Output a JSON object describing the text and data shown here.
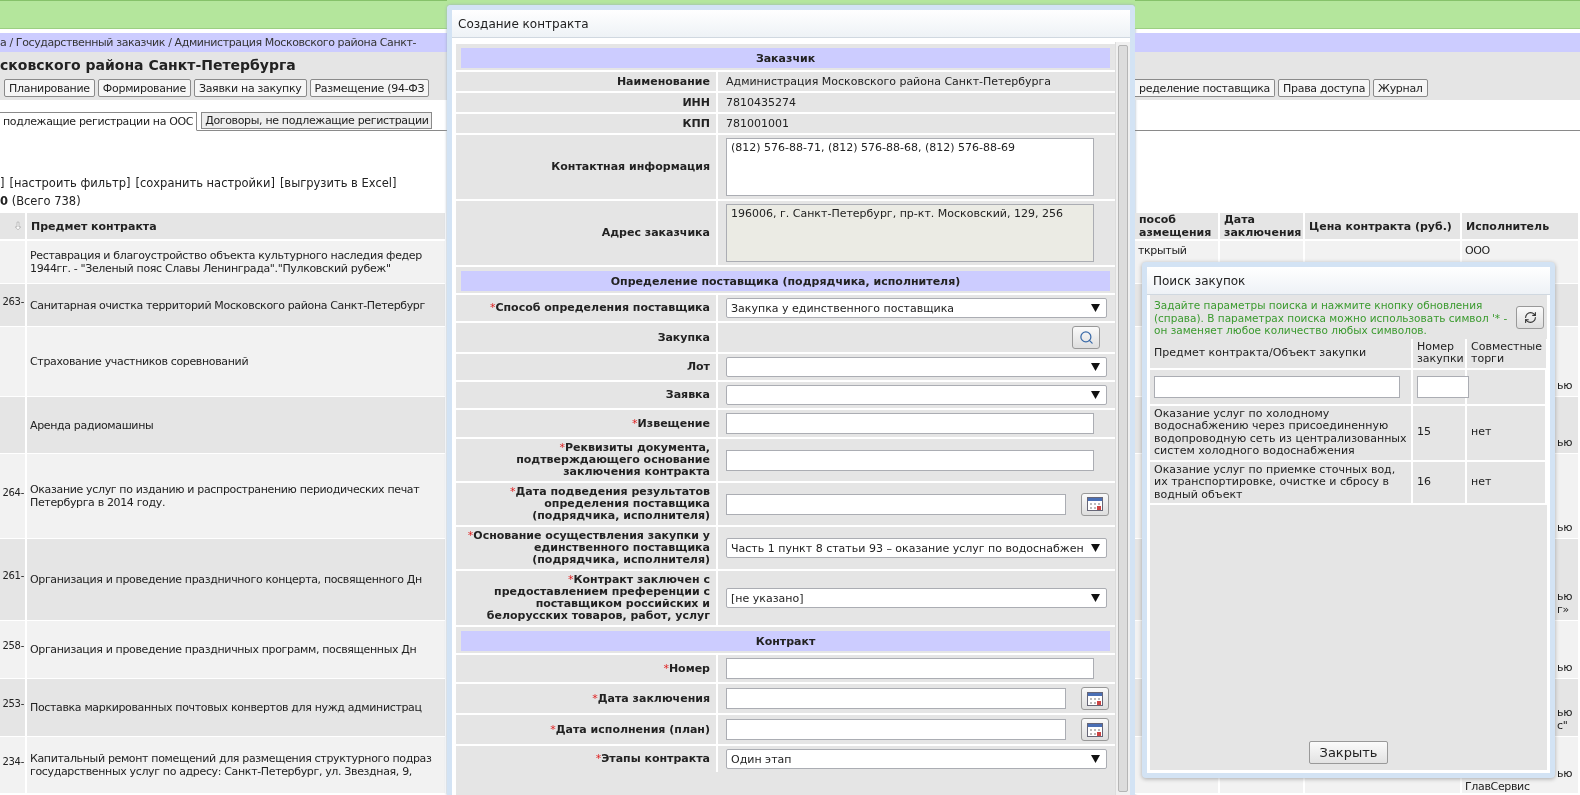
{
  "page": {
    "breadcrumb": "а / Государственный заказчик / Администрация Московского района Санкт-",
    "title": "сковского района Санкт-Петербурга",
    "nav_left": [
      "Планирование",
      "Формирование",
      "Заявки на закупку",
      "Размещение (94-ФЗ"
    ],
    "nav_right": [
      "ределение поставщика",
      "Права доступа",
      "Журнал"
    ],
    "subtabs": [
      {
        "label": "подлежащие регистрации на ООС",
        "selected": true
      },
      {
        "label": "Договоры, не подлежащие регистрации",
        "selected": false
      }
    ],
    "toolbar_fragment": "]",
    "toolbar_links": [
      "[настроить фильтр]",
      "[сохранить настройки]",
      "[выгрузить в Excel]"
    ],
    "count": "**0** (Всего 738)",
    "table_left": {
      "columns": [
        "Предмет контракта"
      ],
      "rows": [
        {
          "lines": [
            "Реставрация и благоустройство объекта культурного наследия федер",
            "1944гг. - \"Зеленый пояс Славы Ленинграда\".\"Пулковский рубеж\""
          ]
        },
        {
          "number": "263-",
          "lines": [
            "Санитарная очистка территорий Московского района Санкт-Петербург"
          ]
        },
        {
          "lines": [
            "Страхование участников соревнований"
          ]
        },
        {
          "lines": [
            "Аренда радиомашины"
          ]
        },
        {
          "number": "264-",
          "lines": [
            "Оказание услуг по изданию и распространению периодических печат",
            "Петербурга в 2014 году."
          ]
        },
        {
          "number": "261-",
          "lines": [
            "Организация и проведение праздничного концерта, посвященного Дн"
          ]
        },
        {
          "number": "258-",
          "lines": [
            "Организация и проведение праздничных программ, посвященных Дн"
          ]
        },
        {
          "number": "253-",
          "lines": [
            "Поставка маркированных почтовых конвертов для нужд администрац"
          ]
        },
        {
          "number": "234-",
          "lines": [
            "Капитальный ремонт помещений для размещения структурного подраз",
            "государственных услуг по адресу: Санкт-Петербург, ул. Звездная, 9,"
          ]
        }
      ]
    },
    "table_right": {
      "columns": [
        "пособ\nазмещения",
        "Дата заключения",
        "Цена контракта (руб.)",
        "Исполнитель"
      ],
      "rows": [
        {
          "method": "ткрытый",
          "executor": [
            {
              "text": "ООО",
              "kind": "full"
            }
          ]
        },
        {
          "executor": []
        },
        {
          "executor": [
            {
              "text": "ью",
              "kind": "fragment"
            }
          ]
        },
        {
          "executor": [
            {
              "text": "ью",
              "kind": "fragment"
            }
          ]
        },
        {
          "executor": [
            {
              "text": "ью",
              "kind": "fragment"
            }
          ]
        },
        {
          "executor": [
            {
              "text": "ью",
              "kind": "fragment"
            },
            {
              "text": "г»",
              "kind": "fragment"
            }
          ]
        },
        {
          "executor": [
            {
              "text": "ью",
              "kind": "fragment"
            }
          ]
        },
        {
          "executor": [
            {
              "text": "ью",
              "kind": "fragment"
            },
            {
              "text": "с\"",
              "kind": "fragment"
            }
          ]
        },
        {
          "executor": [
            {
              "text": "ью",
              "kind": "fragment"
            },
            {
              "text": "ГлавСервис",
              "kind": "full"
            }
          ]
        }
      ]
    }
  },
  "contract_dialog": {
    "title": "Создание контракта",
    "sections": [
      {
        "title": "Заказчик",
        "rows": [
          {
            "kind": "text",
            "label": "Наименование",
            "value": "Администрация Московского района Санкт-Петербурга"
          },
          {
            "kind": "text",
            "label": "ИНН",
            "value": "7810435274"
          },
          {
            "kind": "text",
            "label": "КПП",
            "value": "781001001"
          },
          {
            "kind": "textarea",
            "label": "Контактная информация",
            "value": "(812) 576-88-71, (812) 576-88-68, (812) 576-88-69",
            "disabled": false
          },
          {
            "kind": "textarea",
            "label": "Адрес заказчика",
            "value": "196006, г. Санкт-Петербург, пр-кт. Московский, 129, 256",
            "disabled": true
          }
        ]
      },
      {
        "title": "Определение поставщика (подрядчика, исполнителя)",
        "rows": [
          {
            "kind": "select",
            "mark": "*",
            "label": "Способ определения поставщика",
            "value": "Закупка у единственного поставщика"
          },
          {
            "kind": "search",
            "label": "Закупка"
          },
          {
            "kind": "select",
            "label": "Лот"
          },
          {
            "kind": "select",
            "label": "Заявка"
          },
          {
            "kind": "input",
            "mark": "*",
            "label": "Извещение"
          },
          {
            "kind": "input",
            "mark": "*",
            "label": "Реквизиты документа, подтверждающего основание заключения контракта"
          },
          {
            "kind": "date",
            "mark": "*",
            "label": "Дата подведения результатов определения поставщика (подрядчика, исполнителя)"
          },
          {
            "kind": "select",
            "mark": "*",
            "label": "Основание осуществления закупки у единственного поставщика (подрядчика, исполнителя)",
            "value": "Часть 1 пункт 8 статьи 93 – оказание услуг по водоснабжен"
          },
          {
            "kind": "select",
            "mark": "*",
            "label": "Контракт заключен с предоставлением преференции с поставщиком российских и белорусских товаров, работ, услуг",
            "value": "[не указано]"
          }
        ]
      },
      {
        "title": "Контракт",
        "rows": [
          {
            "kind": "input",
            "mark": "*",
            "label": "Номер"
          },
          {
            "kind": "date",
            "mark": "*",
            "label": "Дата заключения"
          },
          {
            "kind": "date",
            "mark": "*",
            "label": "Дата исполнения (план)"
          },
          {
            "kind": "select",
            "mark": "*",
            "label": "Этапы контракта",
            "value": "Один этап"
          }
        ]
      }
    ]
  },
  "search_dialog": {
    "title": "Поиск закупок",
    "hint": "Задайте параметры поиска и нажмите кнопку обновления (справа). В параметрах поиска можно использовать символ '* - он заменяет любое количество любых символов.",
    "columns": [
      "Предмет контракта/Объект закупки",
      "Номер закупки",
      "Совместные торги"
    ],
    "rows": [
      {
        "subject": "Оказание услуг по холодному водоснабжению через присоединенную водопроводную сеть из централизованных систем холодного водоснабжения",
        "number": "15",
        "joint": "нет"
      },
      {
        "subject": "Оказание услуг по приемке сточных вод, их транспортировке, очистке и сбросу в водный объект",
        "number": "16",
        "joint": "нет"
      }
    ],
    "close_button": "Закрыть"
  }
}
